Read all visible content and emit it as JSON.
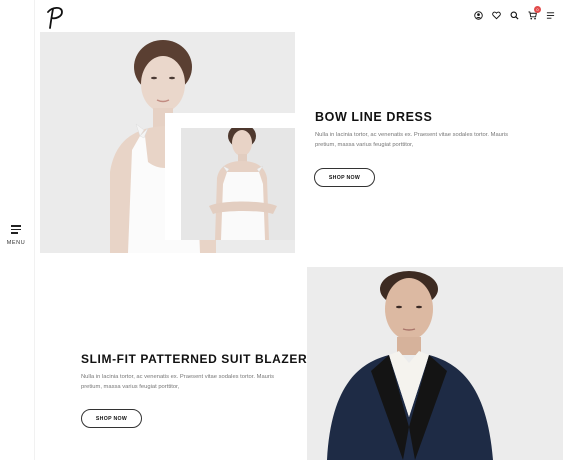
{
  "header": {
    "logo_glyph": "P",
    "icons": [
      "user-icon",
      "heart-icon",
      "search-icon",
      "cart-icon",
      "hamburger-icon"
    ],
    "cart_count": "0"
  },
  "rail": {
    "menu_label": "MENU"
  },
  "section1": {
    "title": "BOW LINE DRESS",
    "description": "Nulla in lacinia tortor, ac venenatis ex. Praesent vitae sodales tortor. Mauris pretium, massa varius feugiat porttitor,",
    "button_label": "SHOP NOW"
  },
  "section2": {
    "title": "SLIM-FIT PATTERNED SUIT BLAZER",
    "description": "Nulla in lacinia tortor, ac venenatis ex. Praesent vitae sodales tortor. Mauris pretium, massa varius feugiat porttitor,",
    "button_label": "SHOP NOW"
  },
  "colors": {
    "accent": "#e24a4a",
    "text": "#111111",
    "muted": "#777777"
  }
}
